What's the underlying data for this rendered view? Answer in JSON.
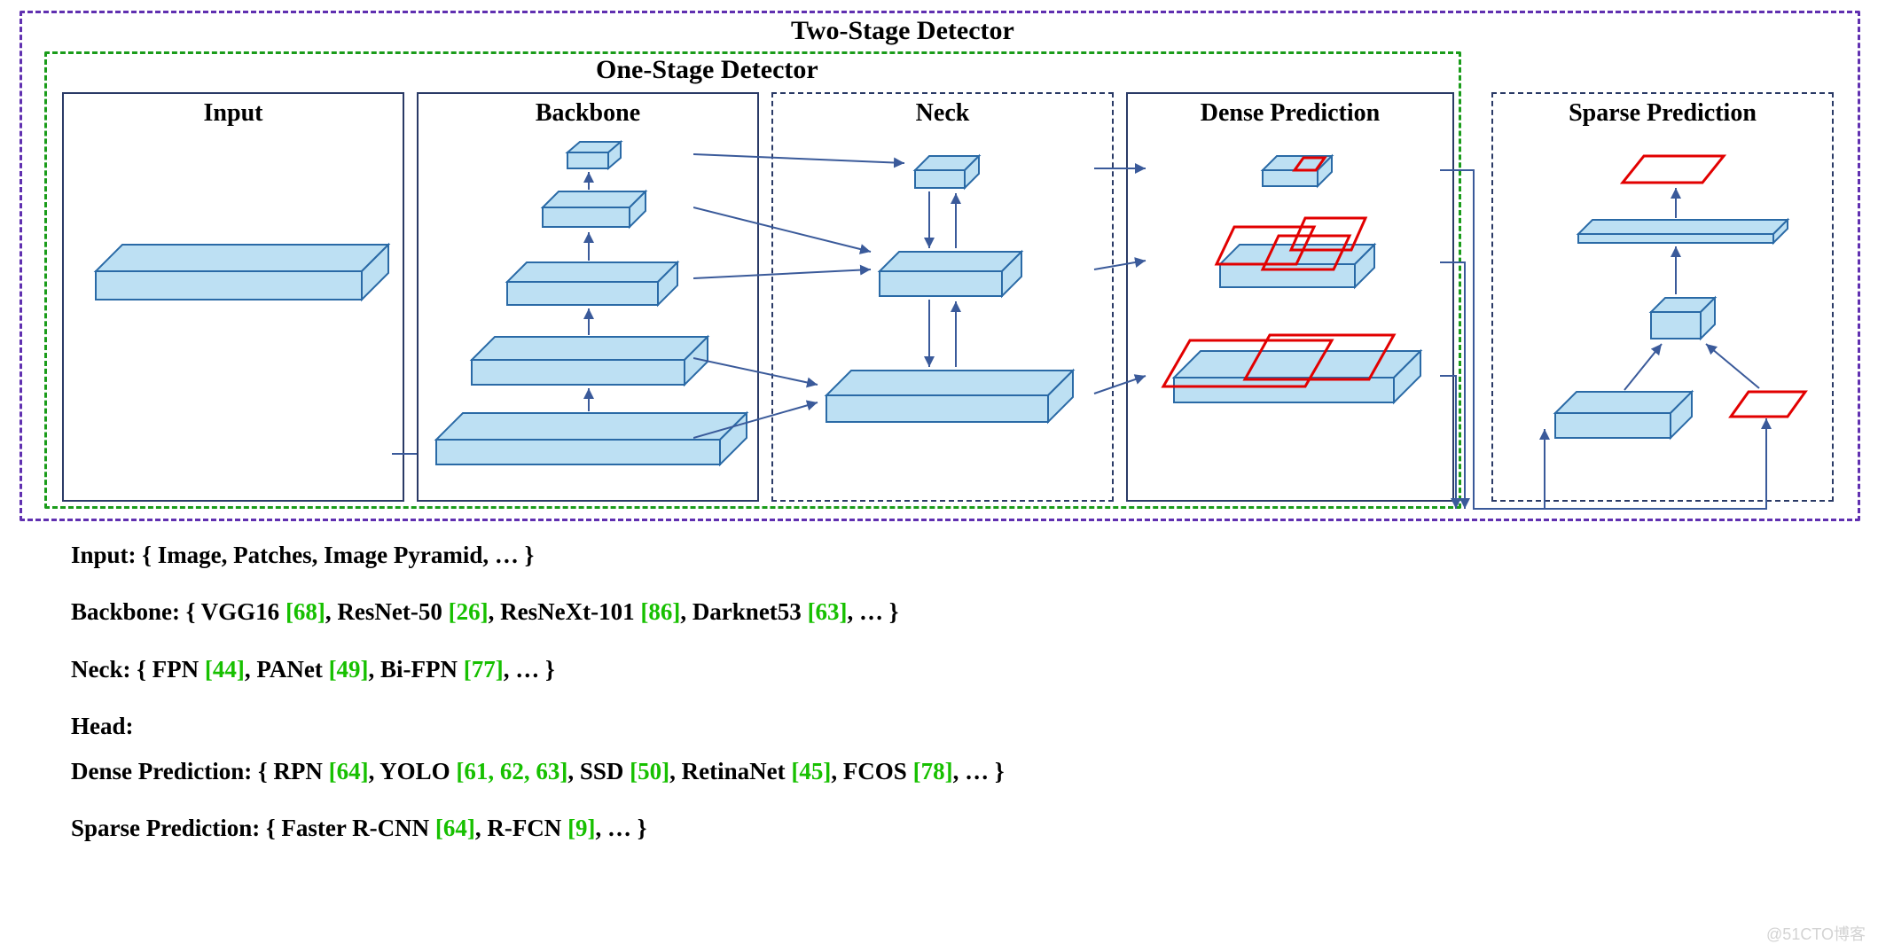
{
  "labels": {
    "two_stage": "Two-Stage Detector",
    "one_stage": "One-Stage Detector",
    "input": "Input",
    "backbone": "Backbone",
    "neck": "Neck",
    "dense": "Dense Prediction",
    "sparse": "Sparse Prediction"
  },
  "captions": {
    "input_label": "Input: { ",
    "input_body": "Image, Patches, Image Pyramid, …",
    "input_end": " }",
    "backbone_label": "Backbone: { ",
    "backbone_items": [
      {
        "name": "VGG16 ",
        "cite": "[68]"
      },
      {
        "name": ", ResNet-50 ",
        "cite": "[26]"
      },
      {
        "name": ", ResNeXt-101 ",
        "cite": "[86]"
      },
      {
        "name": ", Darknet53 ",
        "cite": "[63]"
      }
    ],
    "backbone_end": ", … }",
    "neck_label": "Neck: { ",
    "neck_items": [
      {
        "name": "FPN ",
        "cite": "[44]"
      },
      {
        "name": ", PANet ",
        "cite": "[49]"
      },
      {
        "name": ", Bi-FPN ",
        "cite": "[77]"
      }
    ],
    "neck_end": ", … }",
    "head_label": "Head:",
    "dense_label": "Dense Prediction: { ",
    "dense_items": [
      {
        "name": "RPN ",
        "cite": "[64]"
      },
      {
        "name": ", YOLO ",
        "cite": "[61, 62, 63]"
      },
      {
        "name": ", SSD ",
        "cite": "[50]"
      },
      {
        "name": ", RetinaNet ",
        "cite": "[45]"
      },
      {
        "name": ", FCOS ",
        "cite": "[78]"
      }
    ],
    "dense_end": ", … }",
    "sparse_label": "Sparse Prediction: { ",
    "sparse_items": [
      {
        "name": "Faster R-CNN ",
        "cite": "[64]"
      },
      {
        "name": ",  R-FCN ",
        "cite": "[9]"
      }
    ],
    "sparse_end": ", … }"
  },
  "watermark": "@51CTO博客"
}
